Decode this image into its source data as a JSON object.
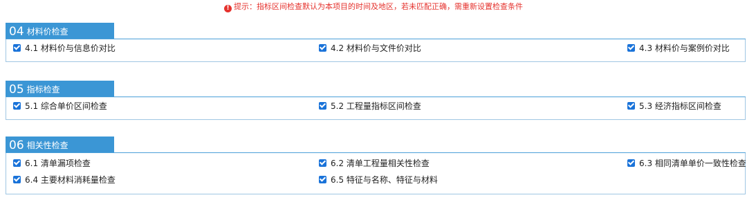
{
  "notice": {
    "text": "提示：指标区间检查默认为本项目的时间及地区，若未匹配正确，需重新设置检查条件",
    "icon": "warning-icon",
    "color": "#e5322d"
  },
  "accent_color": "#3b96d5",
  "checkbox_color": "#1a73d9",
  "sections": [
    {
      "num": "04",
      "title": "材料价检查",
      "items": [
        {
          "label": "4.1 材料价与信息价对比",
          "checked": true
        },
        {
          "label": "4.2 材料价与文件价对比",
          "checked": true
        },
        {
          "label": "4.3 材料价与案例价对比",
          "checked": true
        }
      ]
    },
    {
      "num": "05",
      "title": "指标检查",
      "items": [
        {
          "label": "5.1 综合单价区间检查",
          "checked": true
        },
        {
          "label": "5.2 工程量指标区间检查",
          "checked": true
        },
        {
          "label": "5.3 经济指标区间检查",
          "checked": true
        }
      ]
    },
    {
      "num": "06",
      "title": "相关性检查",
      "items": [
        {
          "label": "6.1 清单漏项检查",
          "checked": true
        },
        {
          "label": "6.2 清单工程量相关性检查",
          "checked": true
        },
        {
          "label": "6.3 相同清单单价一致性检查",
          "checked": true
        },
        {
          "label": "6.4 主要材料消耗量检查",
          "checked": true
        },
        {
          "label": "6.5 特征与名称、特征与材料",
          "checked": true
        }
      ]
    }
  ]
}
